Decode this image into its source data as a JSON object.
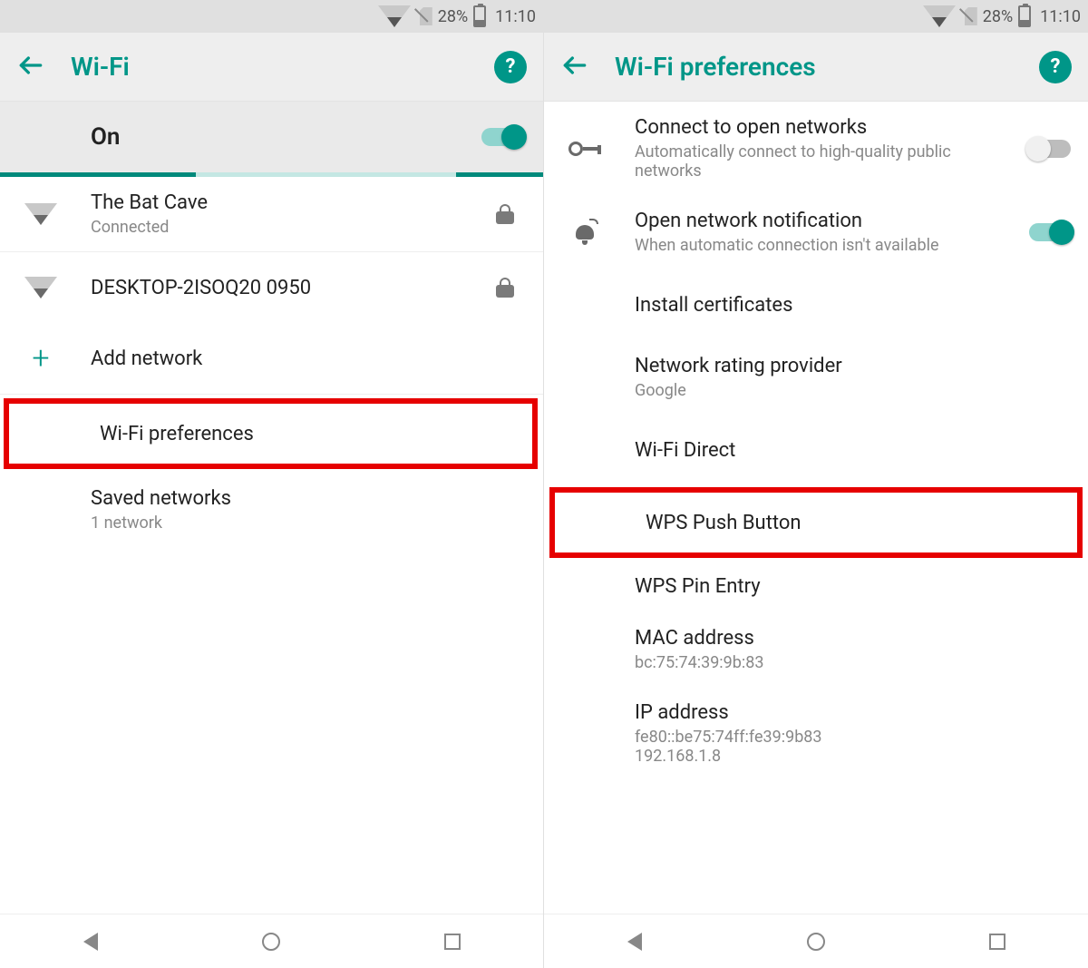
{
  "status": {
    "battery_pct": "28%",
    "time": "11:10"
  },
  "left": {
    "title": "Wi-Fi",
    "toggle": {
      "label": "On",
      "state": "on"
    },
    "networks": [
      {
        "ssid": "The Bat Cave",
        "status": "Connected",
        "secured": true
      },
      {
        "ssid": "DESKTOP-2ISOQ20 0950",
        "status": "",
        "secured": true
      }
    ],
    "add_network": "Add network",
    "wifi_preferences": "Wi-Fi preferences",
    "saved_networks": {
      "title": "Saved networks",
      "subtitle": "1 network"
    }
  },
  "right": {
    "title": "Wi-Fi preferences",
    "items": {
      "connect_open": {
        "title": "Connect to open networks",
        "subtitle": "Automatically connect to high-quality public networks",
        "toggle": "off"
      },
      "open_notif": {
        "title": "Open network notification",
        "subtitle": "When automatic connection isn't available",
        "toggle": "on"
      },
      "install_cert": "Install certificates",
      "rating_provider": {
        "title": "Network rating provider",
        "subtitle": "Google"
      },
      "wifi_direct": "Wi-Fi Direct",
      "wps_push": "WPS Push Button",
      "wps_pin": "WPS Pin Entry",
      "mac": {
        "title": "MAC address",
        "value": "bc:75:74:39:9b:83"
      },
      "ip": {
        "title": "IP address",
        "value1": "fe80::be75:74ff:fe39:9b83",
        "value2": "192.168.1.8"
      }
    }
  }
}
